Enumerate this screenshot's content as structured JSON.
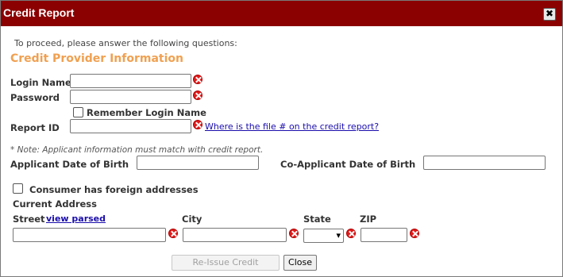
{
  "window": {
    "title": "Credit Report",
    "close_glyph": "✖"
  },
  "form": {
    "intro": "To proceed, please answer the following questions:",
    "section_title": "Credit Provider Information",
    "login_name": {
      "label": "Login Name",
      "value": ""
    },
    "password": {
      "label": "Password",
      "value": ""
    },
    "remember_login": {
      "label": "Remember Login Name",
      "checked": false
    },
    "report_id": {
      "label": "Report ID",
      "value": "",
      "help_link": "Where is the file # on the credit report?"
    },
    "note": "* Note: Applicant information must match with credit report.",
    "applicant_dob": {
      "label": "Applicant Date of Birth",
      "value": ""
    },
    "coapplicant_dob": {
      "label": "Co-Applicant Date of Birth",
      "value": ""
    },
    "foreign_addresses": {
      "label": "Consumer has foreign addresses",
      "checked": false
    },
    "current_address": {
      "heading": "Current Address",
      "street_label": "Street",
      "view_parsed_link": "view parsed",
      "city_label": "City",
      "state_label": "State",
      "zip_label": "ZIP",
      "street_value": "",
      "city_value": "",
      "state_value": "",
      "zip_value": ""
    }
  },
  "buttons": {
    "reissue": "Re-Issue Credit",
    "close": "Close"
  },
  "colors": {
    "title_bar": "#8b0000",
    "section_title": "#f0a050",
    "error_icon": "#e21b1b",
    "link": "#1a0dab"
  },
  "icons": {
    "error": "error-x-icon",
    "close": "close-icon",
    "dropdown": "chevron-down-icon"
  }
}
